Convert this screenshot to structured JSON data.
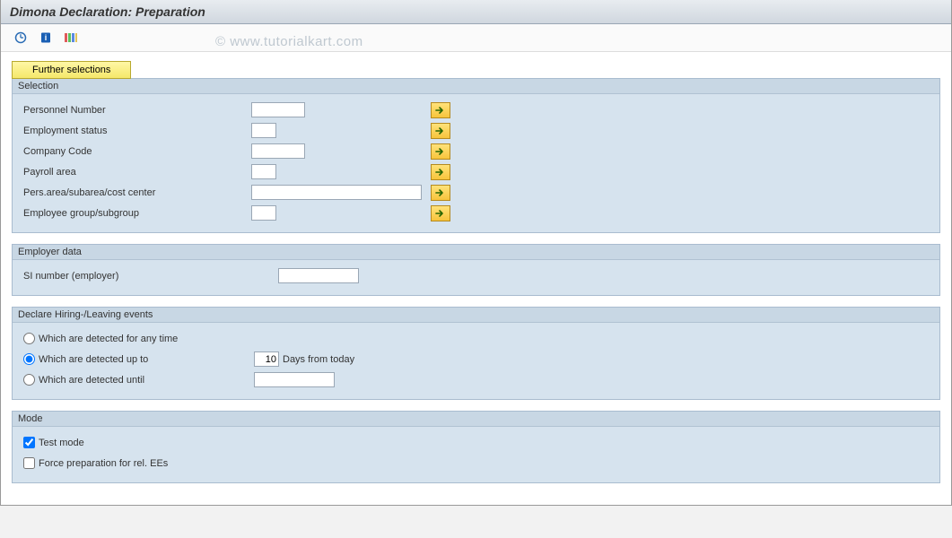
{
  "title": "Dimona Declaration: Preparation",
  "watermark": "© www.tutorialkart.com",
  "toolbar": {
    "execute": "Execute",
    "info": "Info",
    "variant": "Variant"
  },
  "further_selections": "Further selections",
  "groups": {
    "selection": {
      "title": "Selection",
      "fields": {
        "personnel_number": {
          "label": "Personnel Number",
          "value": ""
        },
        "employment_status": {
          "label": "Employment status",
          "value": ""
        },
        "company_code": {
          "label": "Company Code",
          "value": ""
        },
        "payroll_area": {
          "label": "Payroll area",
          "value": ""
        },
        "pers_area": {
          "label": "Pers.area/subarea/cost center",
          "value": ""
        },
        "employee_group": {
          "label": "Employee group/subgroup",
          "value": ""
        }
      }
    },
    "employer_data": {
      "title": "Employer data",
      "si_number_label": "SI number (employer)",
      "si_number_value": ""
    },
    "declare": {
      "title": "Declare Hiring-/Leaving events",
      "options": {
        "any_time": "Which are detected for any time",
        "up_to": "Which are detected up to",
        "up_to_value": "10",
        "up_to_suffix": "Days from today",
        "until": "Which are detected until",
        "until_value": ""
      },
      "selected": "up_to"
    },
    "mode": {
      "title": "Mode",
      "test_mode_label": "Test mode",
      "test_mode_checked": true,
      "force_prep_label": "Force preparation for rel. EEs",
      "force_prep_checked": false
    }
  }
}
